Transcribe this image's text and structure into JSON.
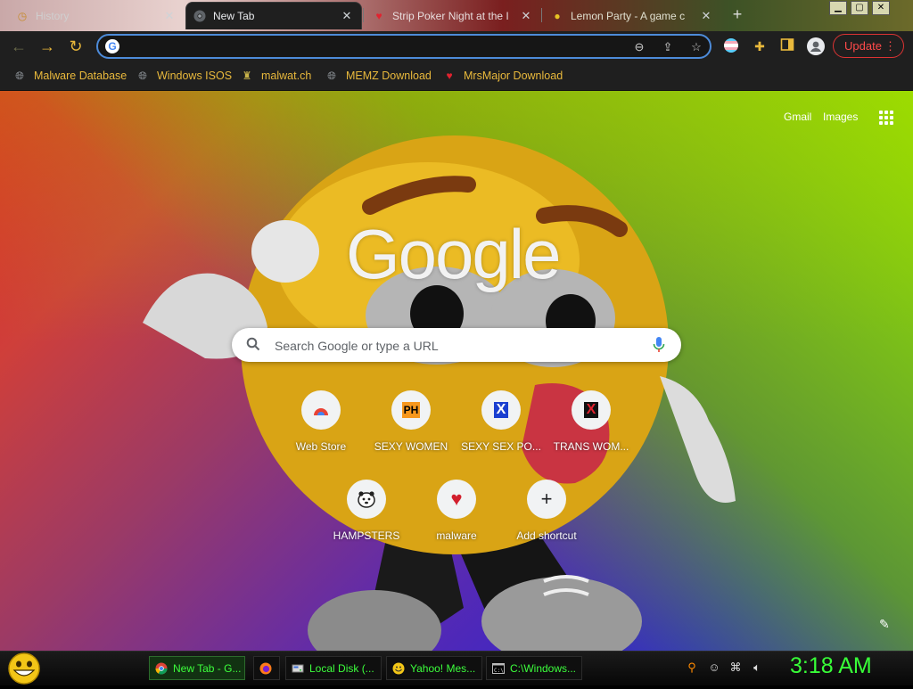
{
  "browser": {
    "tabs": [
      {
        "title": "History",
        "favicon": "history-icon",
        "active": false
      },
      {
        "title": "New Tab",
        "favicon": "chrome-icon",
        "active": true
      },
      {
        "title": "Strip Poker Night at the I",
        "favicon": "heart-icon",
        "active": false
      },
      {
        "title": "Lemon Party - A game c",
        "favicon": "lemon-icon",
        "active": false
      }
    ],
    "close_glyph": "✕",
    "new_tab_glyph": "+",
    "window_controls": [
      "▁",
      "▢",
      "✕"
    ],
    "omnibox": {
      "value": "",
      "placeholder": ""
    },
    "update_label": "Update",
    "menu_glyph": "⋮",
    "bookmarks": [
      {
        "label": "Malware Database",
        "icon": "globe-icon"
      },
      {
        "label": "Windows ISOS",
        "icon": "globe-icon"
      },
      {
        "label": "malwat.ch",
        "icon": "malwatch-icon"
      },
      {
        "label": "MEMZ Download",
        "icon": "globe-icon"
      },
      {
        "label": "MrsMajor Download",
        "icon": "heart-icon"
      }
    ]
  },
  "ntp": {
    "links": {
      "gmail": "Gmail",
      "images": "Images"
    },
    "logo": "Google",
    "search_placeholder": "Search Google or type a URL",
    "shortcuts": [
      {
        "label": "Web Store",
        "icon": "webstore-icon",
        "glyph": "◓"
      },
      {
        "label": "SEXY WOMEN",
        "icon": "ph-icon",
        "glyph": "PH"
      },
      {
        "label": "SEXY SEX PO...",
        "icon": "x-icon",
        "glyph": "X"
      },
      {
        "label": "TRANS WOM...",
        "icon": "x-red-icon",
        "glyph": "X"
      },
      {
        "label": "HAMPSTERS",
        "icon": "hamster-icon",
        "glyph": "🐹"
      },
      {
        "label": "malware",
        "icon": "heart-icon",
        "glyph": "♥"
      },
      {
        "label": "Add shortcut",
        "icon": "plus-icon",
        "glyph": "+"
      }
    ]
  },
  "taskbar": {
    "tasks": [
      {
        "label": "New Tab - G...",
        "icon": "chrome-icon",
        "active": true
      },
      {
        "label": "",
        "icon": "firefox-icon",
        "active": false
      },
      {
        "label": "Local Disk (...",
        "icon": "drive-icon",
        "active": false
      },
      {
        "label": "Yahoo! Mes...",
        "icon": "yahoo-messenger-icon",
        "active": false
      },
      {
        "label": "C:\\Windows...",
        "icon": "cmd-icon",
        "active": false
      }
    ],
    "clock": "3:18 AM"
  },
  "colors": {
    "accent_gold": "#e9b93c",
    "update_red": "#ff4a4a",
    "taskbar_green": "#3cff3c",
    "omnibox_border": "#4d8bd9"
  }
}
